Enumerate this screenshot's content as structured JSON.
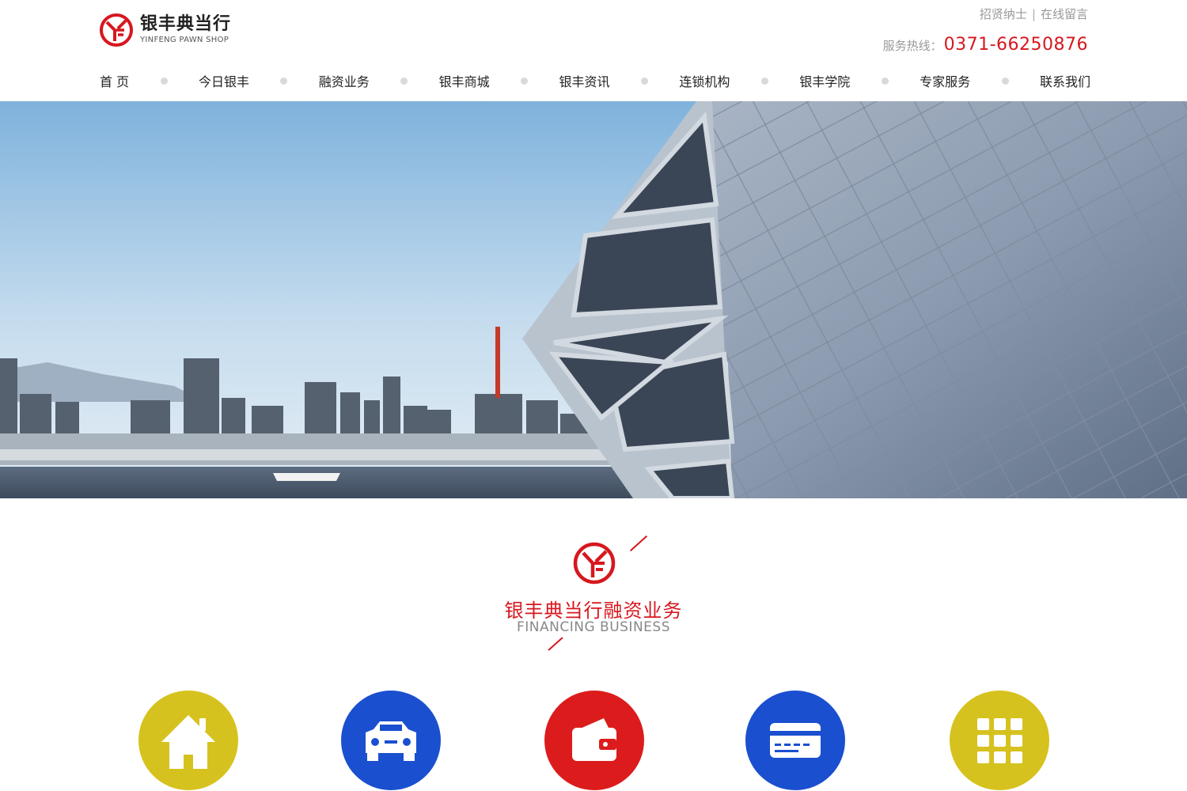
{
  "header": {
    "logo_cn": "银丰典当行",
    "logo_en": "YINFENG PAWN SHOP",
    "top_links": [
      "招贤纳士",
      "在线留言"
    ],
    "hotline_label": "服务热线：",
    "hotline_number": "0371-66250876"
  },
  "nav": {
    "items": [
      "首 页",
      "今日银丰",
      "融资业务",
      "银丰商城",
      "银丰资讯",
      "连锁机构",
      "银丰学院",
      "专家服务",
      "联系我们"
    ]
  },
  "section": {
    "title_cn": "银丰典当行融资业务",
    "title_en": "FINANCING BUSINESS"
  },
  "services": [
    {
      "icon": "house-icon",
      "color": "#d6c21e"
    },
    {
      "icon": "car-icon",
      "color": "#1a4fcf"
    },
    {
      "icon": "wallet-icon",
      "color": "#dc1c1c"
    },
    {
      "icon": "card-icon",
      "color": "#1a4fcf"
    },
    {
      "icon": "grid-icon",
      "color": "#d6c21e"
    }
  ],
  "colors": {
    "brand_red": "#d7171e",
    "nav_dot": "#d9d9d9"
  }
}
